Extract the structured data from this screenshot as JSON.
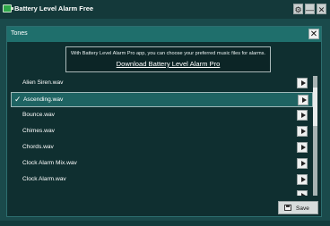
{
  "app": {
    "title": "Battery Level Alarm Free",
    "icon": "battery-icon",
    "controls": {
      "settings": "gear-icon",
      "minimize": "minimize-icon",
      "close": "close-icon"
    }
  },
  "dialog": {
    "title": "Tones",
    "close_icon": "close-icon",
    "promo": {
      "text": "With Battery Level Alarm Pro app, you can choose your preferred music files for alarms.",
      "link": "Download Battery Level Alarm Pro"
    },
    "tones": [
      {
        "name": "Alien Siren.wav",
        "selected": false
      },
      {
        "name": "Ascending.wav",
        "selected": true
      },
      {
        "name": "Bounce.wav",
        "selected": false
      },
      {
        "name": "Chimes.wav",
        "selected": false
      },
      {
        "name": "Chords.wav",
        "selected": false
      },
      {
        "name": "Clock Alarm Mix.wav",
        "selected": false
      },
      {
        "name": "Clock Alarm.wav",
        "selected": false
      },
      {
        "name": "",
        "selected": false
      }
    ],
    "check_mark": "✓",
    "save_label": "Save"
  },
  "colors": {
    "background": "#1a4a4b",
    "titlebar": "#14393a",
    "dialog_header": "#1f6f6c",
    "selected_row": "#1e6362"
  }
}
